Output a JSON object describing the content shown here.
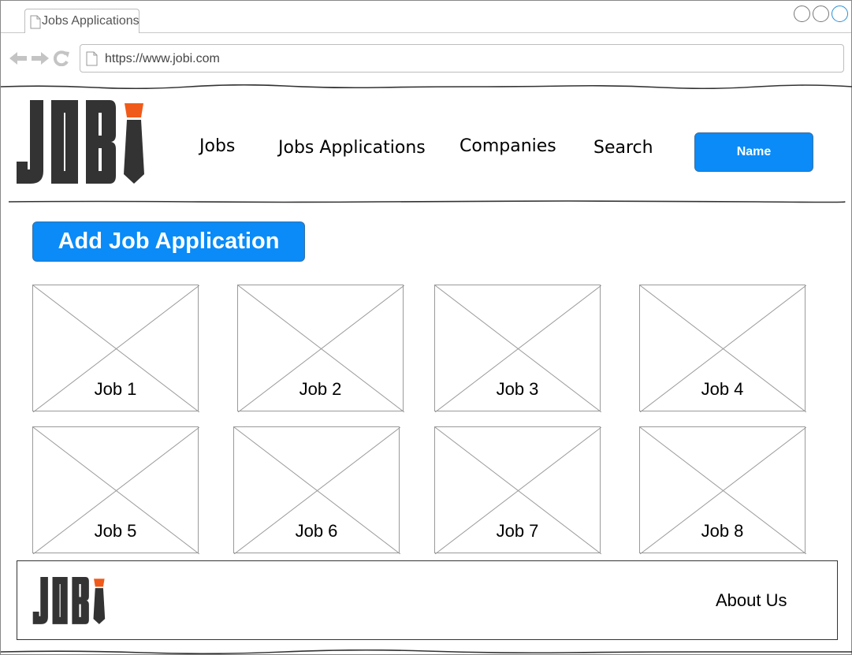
{
  "browser": {
    "tab_title": "Jobs Applications",
    "url": "https://www.jobi.com",
    "icons": [
      "page-icon",
      "back-arrow-icon",
      "forward-arrow-icon",
      "reload-icon"
    ]
  },
  "brand": {
    "logo_text": "JOBI",
    "colors": {
      "logo_dark": "#333333",
      "logo_accent": "#f05a1a",
      "primary": "#0a8bf7"
    }
  },
  "nav": {
    "items": [
      "Jobs",
      "Jobs Applications",
      "Companies",
      "Search"
    ],
    "user_button": "Name"
  },
  "main": {
    "add_button": "Add Job Application",
    "jobs": [
      "Job 1",
      "Job 2",
      "Job 3",
      "Job 4",
      "Job 5",
      "Job 6",
      "Job 7",
      "Job 8"
    ]
  },
  "footer": {
    "about_link": "About Us"
  }
}
